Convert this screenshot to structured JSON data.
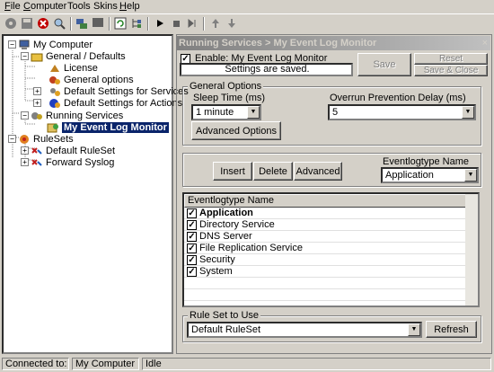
{
  "menu": [
    {
      "label": "File",
      "underline": "F",
      "rest": "ile"
    },
    {
      "label": "Computer",
      "underline": "C",
      "rest": "omputer"
    },
    {
      "label": "Tools",
      "underline": "",
      "rest": "Tools"
    },
    {
      "label": "Skins",
      "underline": "",
      "rest": "Skins"
    },
    {
      "label": "Help",
      "underline": "H",
      "rest": "elp"
    }
  ],
  "tree": {
    "root": "My Computer",
    "general": "General / Defaults",
    "license": "License",
    "general_options": "General options",
    "default_services": "Default Settings for Services",
    "default_actions": "Default Settings for Actions",
    "running_services": "Running Services",
    "event_log_monitor": "My Event Log Monitor",
    "rulesets": "RuleSets",
    "default_ruleset": "Default RuleSet",
    "forward_syslog": "Forward Syslog"
  },
  "panel": {
    "title": "Running Services > My Event Log Monitor",
    "close": "×",
    "enable_label": "Enable: My Event Log Monitor",
    "status": "Settings are saved.",
    "save": "Save",
    "reset": "Reset",
    "save_close": "Save & Close"
  },
  "general_options": {
    "label": "General Options",
    "sleep_label": "Sleep Time (ms)",
    "sleep_value": "1 minute",
    "overrun_label": "Overrun Prevention Delay (ms)",
    "overrun_value": "5",
    "advanced_options": "Advanced Options"
  },
  "event_toolbar": {
    "insert": "Insert",
    "delete": "Delete",
    "advanced": "Advanced",
    "type_label": "Eventlogtype Name",
    "type_value": "Application"
  },
  "list": {
    "header": "Eventlogtype Name",
    "rows": [
      "Application",
      "Directory Service",
      "DNS Server",
      "File Replication Service",
      "Security",
      "System"
    ]
  },
  "ruleset": {
    "label": "Rule Set to Use",
    "value": "Default RuleSet",
    "refresh": "Refresh"
  },
  "statusbar": {
    "connected_label": "Connected to:",
    "computer": "My Computer",
    "state": "Idle"
  }
}
